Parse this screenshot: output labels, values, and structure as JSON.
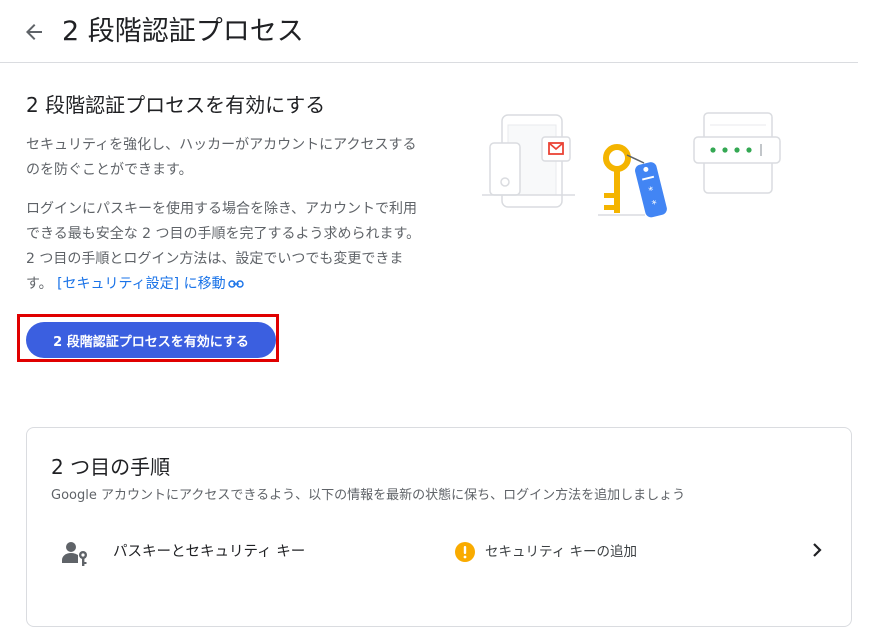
{
  "header": {
    "title": "2 段階認証プロセス"
  },
  "intro": {
    "heading": "2 段階認証プロセスを有効にする",
    "paragraph1": "セキュリティを強化し、ハッカーがアカウントにアクセスするのを防ぐことができます。",
    "paragraph2": "ログインにパスキーを使用する場合を除き、アカウントで利用できる最も安全な 2 つ目の手順を完了するよう求められます。2 つ目の手順とログイン方法は、設定でいつでも変更できます。",
    "link_text": "[セキュリティ設定] に移動",
    "enable_button": "2 段階認証プロセスを有効にする"
  },
  "second_steps": {
    "title": "2 つ目の手順",
    "subtitle": "Google アカウントにアクセスできるよう、以下の情報を最新の状態に保ち、ログイン方法を追加しましょう",
    "rows": [
      {
        "label": "パスキーとセキュリティ キー",
        "status": "セキュリティ キーの追加",
        "status_icon": "warning-icon",
        "icon": "person-key-icon"
      }
    ]
  },
  "colors": {
    "primary_button": "#3b5fe0",
    "highlight_border": "#e00000",
    "link": "#1a73e8",
    "warning": "#f9ab00",
    "key_yellow": "#f4b400",
    "tag_blue": "#4285f4"
  }
}
